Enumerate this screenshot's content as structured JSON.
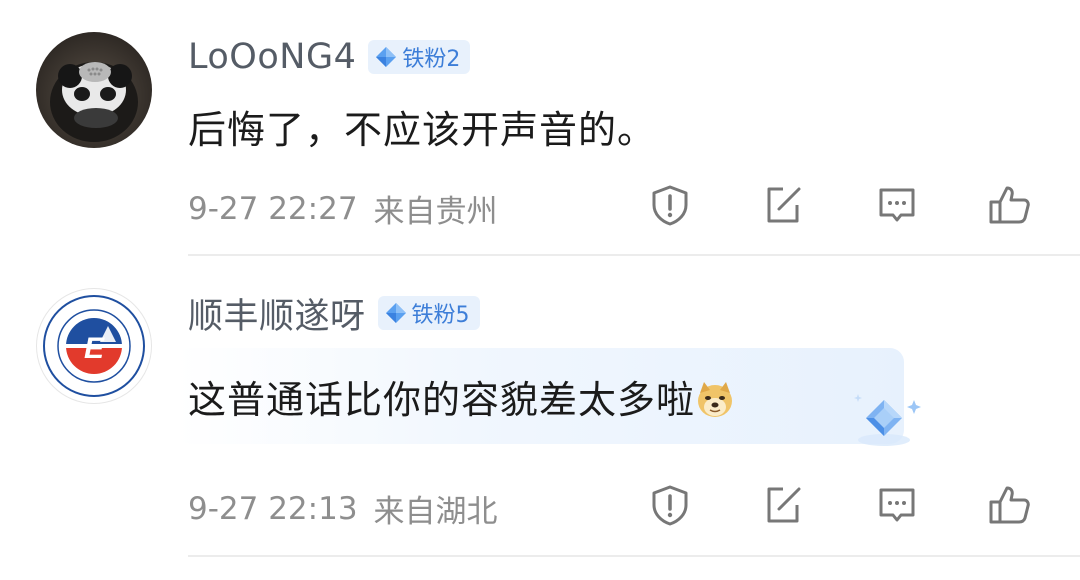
{
  "comments": [
    {
      "username": "LoOoNG4",
      "badge": "铁粉2",
      "text": "后悔了，不应该开声音的。",
      "timestamp": "9-27 22:27",
      "location": "来自贵州",
      "avatar": "panda-avatar"
    },
    {
      "username": "顺丰顺遂呀",
      "badge": "铁粉5",
      "text": "这普通话比你的容貌差太多啦",
      "emoji": "doge-emoji",
      "timestamp": "9-27 22:13",
      "location": "来自湖北",
      "avatar": "university-logo-avatar"
    }
  ],
  "actions": [
    "report-icon",
    "share-icon",
    "reply-icon",
    "like-icon"
  ],
  "colors": {
    "username": "#555c66",
    "badge_bg": "#e8f1fc",
    "badge_text": "#3d7ed8",
    "meta": "#8e8e8e",
    "icon": "#777777",
    "logo_red": "#e23a2c",
    "logo_blue": "#1f4fa0"
  }
}
